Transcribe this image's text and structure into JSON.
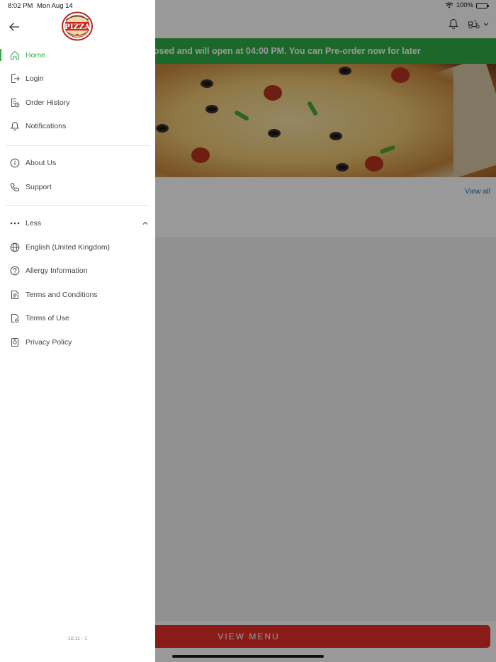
{
  "status_bar": {
    "time": "8:02 PM",
    "date": "Mon Aug 14",
    "battery": "100%"
  },
  "background": {
    "banner_text": "osed and will open at 04:00 PM. You can Pre-order now for later",
    "view_all": "View all",
    "view_menu": "VIEW MENU"
  },
  "drawer": {
    "logo_text": "PIZZA",
    "primary_items": [
      {
        "label": "Home",
        "icon": "home-icon",
        "active": true
      },
      {
        "label": "Login",
        "icon": "login-icon"
      },
      {
        "label": "Order History",
        "icon": "order-history-icon"
      },
      {
        "label": "Notifications",
        "icon": "bell-icon"
      }
    ],
    "secondary_items": [
      {
        "label": "About Us",
        "icon": "info-icon"
      },
      {
        "label": "Support",
        "icon": "phone-icon"
      }
    ],
    "more_toggle": {
      "label": "Less",
      "icon": "more-icon"
    },
    "extra_items": [
      {
        "label": "English (United Kingdom)",
        "icon": "globe-icon"
      },
      {
        "label": "Allergy Information",
        "icon": "question-icon"
      },
      {
        "label": "Terms and Conditions",
        "icon": "document-icon"
      },
      {
        "label": "Terms of Use",
        "icon": "document-settings-icon"
      },
      {
        "label": "Privacy Policy",
        "icon": "privacy-icon"
      }
    ],
    "version": "10.11 - 1"
  },
  "colors": {
    "accent": "#2fae47",
    "brand_red": "#e63027",
    "link_blue": "#1a73c8"
  }
}
